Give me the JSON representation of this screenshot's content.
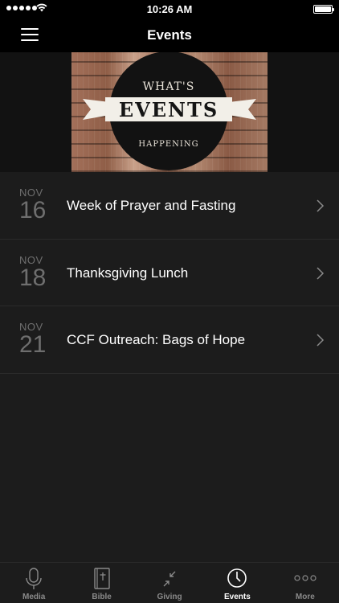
{
  "status_bar": {
    "time": "10:26 AM"
  },
  "nav": {
    "title": "Events",
    "menu_icon": "hamburger-menu-icon"
  },
  "banner": {
    "line1": "WHAT'S",
    "line2": "EVENTS",
    "line3": "HAPPENING"
  },
  "events": [
    {
      "month": "NOV",
      "day": "16",
      "title": "Week of Prayer and Fasting"
    },
    {
      "month": "NOV",
      "day": "18",
      "title": "Thanksgiving Lunch"
    },
    {
      "month": "NOV",
      "day": "21",
      "title": "CCF Outreach: Bags of Hope"
    }
  ],
  "tabs": [
    {
      "label": "Media",
      "icon": "microphone-icon",
      "active": false
    },
    {
      "label": "Bible",
      "icon": "bible-icon",
      "active": false
    },
    {
      "label": "Giving",
      "icon": "giving-icon",
      "active": false
    },
    {
      "label": "Events",
      "icon": "clock-icon",
      "active": true
    },
    {
      "label": "More",
      "icon": "more-icon",
      "active": false
    }
  ],
  "colors": {
    "background": "#1c1c1c",
    "bar": "#000000",
    "date_gray": "#6e6e6e",
    "inactive_tab": "#8a8a8a"
  }
}
